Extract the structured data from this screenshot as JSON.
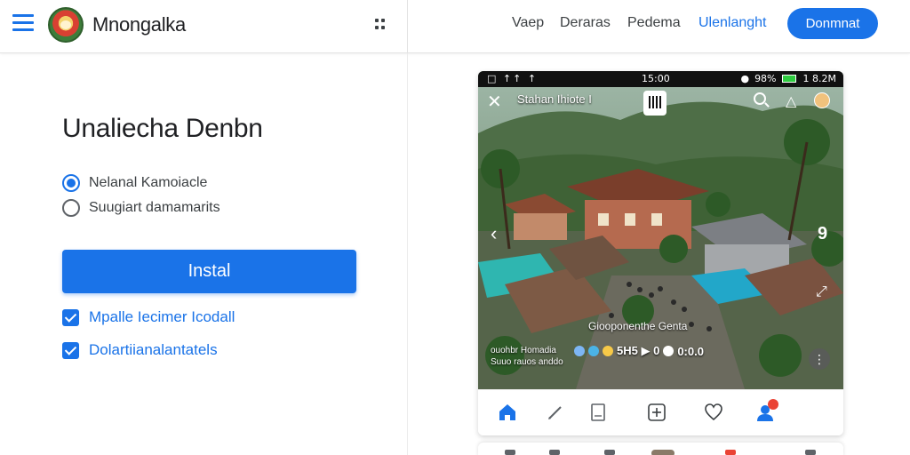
{
  "header": {
    "app_name": "Mnongalka",
    "nav": [
      {
        "label": "Vaep"
      },
      {
        "label": "Deraras"
      },
      {
        "label": "Pedema"
      },
      {
        "label": "Ulenlanght"
      }
    ],
    "cta_label": "Donmnat"
  },
  "form": {
    "title": "Unaliecha Denbn",
    "radios": [
      {
        "label": "Nelanal Kamoiacle",
        "checked": true
      },
      {
        "label": "Suugiart damamarits",
        "checked": false
      }
    ],
    "install_label": "Instal",
    "checkboxes": [
      {
        "label": "Mpalle Iecimer Icodall",
        "checked": true
      },
      {
        "label": "Dolartiianalantatels",
        "checked": true
      }
    ]
  },
  "phone": {
    "status": {
      "left": "□ ↑↑ ↑",
      "clock": "15:00",
      "battery": "98%",
      "time": "1 8.2M"
    },
    "overlay": {
      "title": "Stahan Ihiote I",
      "caption": "Giooponenthe Genta",
      "reactions_text": "5H5 ▶ 0",
      "reactions_count": "0:0.0",
      "footnote_line1": "ouohbr Homadia",
      "footnote_line2": "Suuo rauos anddo"
    },
    "tabs": [
      "home",
      "edit",
      "note",
      "add",
      "heart",
      "profile"
    ]
  },
  "colors": {
    "accent": "#1a73e8",
    "notification": "#ea4335"
  }
}
